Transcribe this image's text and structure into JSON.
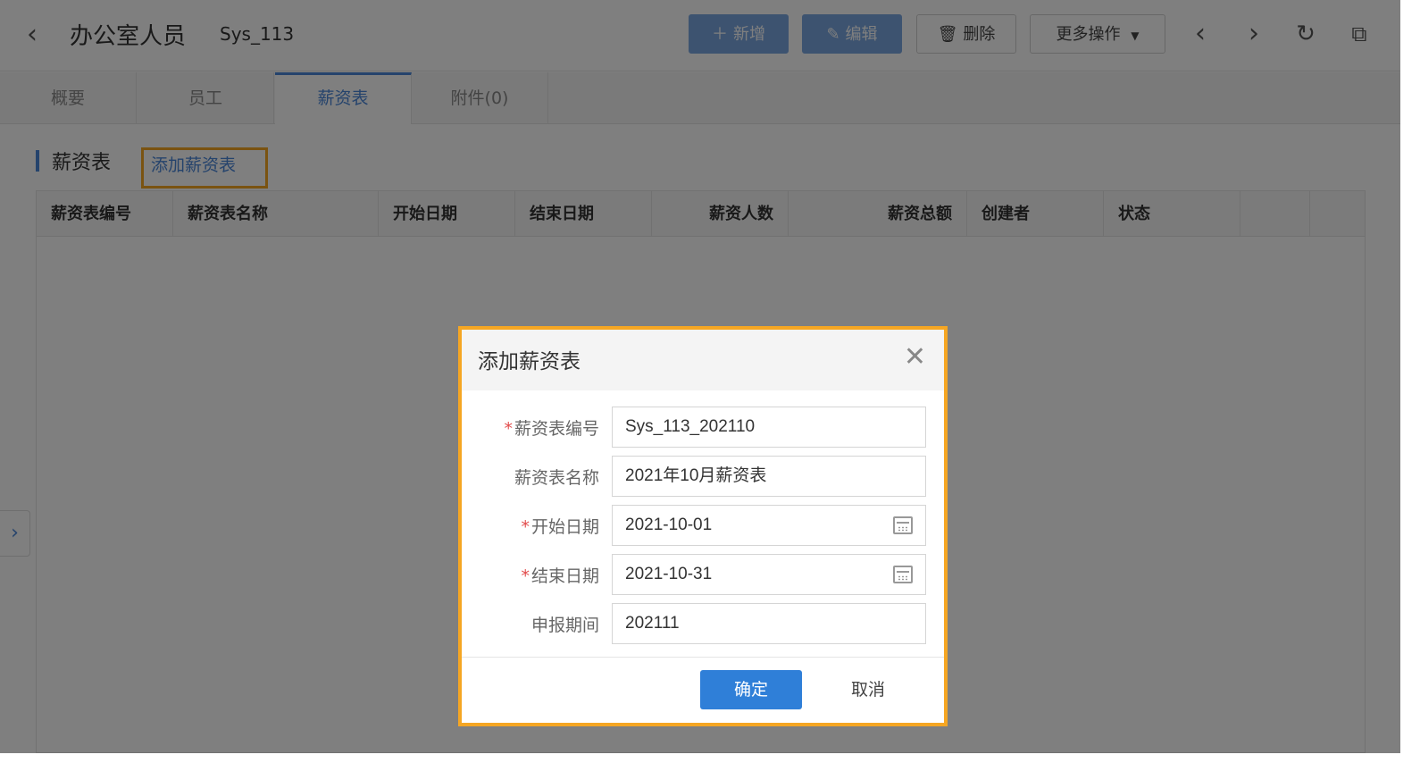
{
  "header": {
    "title": "办公室人员",
    "record_code": "Sys_113",
    "buttons": {
      "add": "新增",
      "edit": "编辑",
      "delete": "删除",
      "more": "更多操作"
    }
  },
  "tabs": [
    "概要",
    "员工",
    "薪资表",
    "附件(0)"
  ],
  "active_tab": "薪资表",
  "section": {
    "title": "薪资表",
    "add_link": "添加薪资表"
  },
  "table": {
    "columns": [
      "薪资表编号",
      "薪资表名称",
      "开始日期",
      "结束日期",
      "薪资人数",
      "薪资总额",
      "创建者",
      "状态"
    ],
    "rows": []
  },
  "modal": {
    "title": "添加薪资表",
    "fields": [
      {
        "label": "薪资表编号",
        "required": true,
        "value": "Sys_113_202110"
      },
      {
        "label": "薪资表名称",
        "required": false,
        "value": "2021年10月薪资表"
      },
      {
        "label": "开始日期",
        "required": true,
        "value": "2021-10-01"
      },
      {
        "label": "结束日期",
        "required": true,
        "value": "2021-10-31"
      },
      {
        "label": "申报期间",
        "required": false,
        "value": "202111"
      }
    ],
    "ok_label": "确定",
    "cancel_label": "取消"
  },
  "colors": {
    "primary": "#2f7fd8",
    "highlight": "#f5a623",
    "required": "#e24b4b"
  }
}
